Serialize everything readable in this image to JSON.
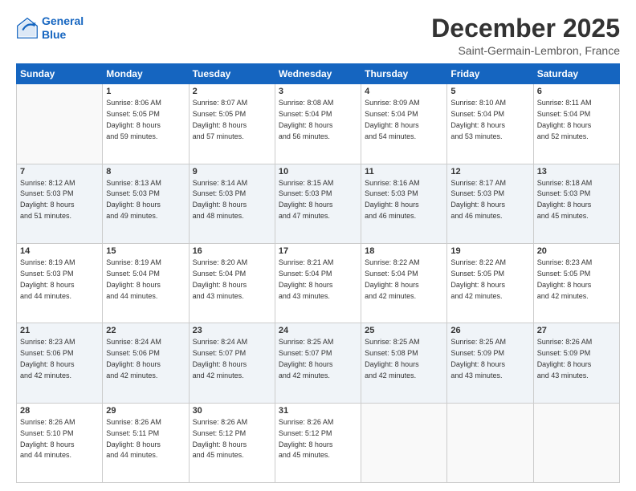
{
  "header": {
    "logo_line1": "General",
    "logo_line2": "Blue",
    "month_title": "December 2025",
    "location": "Saint-Germain-Lembron, France"
  },
  "weekdays": [
    "Sunday",
    "Monday",
    "Tuesday",
    "Wednesday",
    "Thursday",
    "Friday",
    "Saturday"
  ],
  "weeks": [
    [
      {
        "day": "",
        "info": ""
      },
      {
        "day": "1",
        "info": "Sunrise: 8:06 AM\nSunset: 5:05 PM\nDaylight: 8 hours\nand 59 minutes."
      },
      {
        "day": "2",
        "info": "Sunrise: 8:07 AM\nSunset: 5:05 PM\nDaylight: 8 hours\nand 57 minutes."
      },
      {
        "day": "3",
        "info": "Sunrise: 8:08 AM\nSunset: 5:04 PM\nDaylight: 8 hours\nand 56 minutes."
      },
      {
        "day": "4",
        "info": "Sunrise: 8:09 AM\nSunset: 5:04 PM\nDaylight: 8 hours\nand 54 minutes."
      },
      {
        "day": "5",
        "info": "Sunrise: 8:10 AM\nSunset: 5:04 PM\nDaylight: 8 hours\nand 53 minutes."
      },
      {
        "day": "6",
        "info": "Sunrise: 8:11 AM\nSunset: 5:04 PM\nDaylight: 8 hours\nand 52 minutes."
      }
    ],
    [
      {
        "day": "7",
        "info": "Sunrise: 8:12 AM\nSunset: 5:03 PM\nDaylight: 8 hours\nand 51 minutes."
      },
      {
        "day": "8",
        "info": "Sunrise: 8:13 AM\nSunset: 5:03 PM\nDaylight: 8 hours\nand 49 minutes."
      },
      {
        "day": "9",
        "info": "Sunrise: 8:14 AM\nSunset: 5:03 PM\nDaylight: 8 hours\nand 48 minutes."
      },
      {
        "day": "10",
        "info": "Sunrise: 8:15 AM\nSunset: 5:03 PM\nDaylight: 8 hours\nand 47 minutes."
      },
      {
        "day": "11",
        "info": "Sunrise: 8:16 AM\nSunset: 5:03 PM\nDaylight: 8 hours\nand 46 minutes."
      },
      {
        "day": "12",
        "info": "Sunrise: 8:17 AM\nSunset: 5:03 PM\nDaylight: 8 hours\nand 46 minutes."
      },
      {
        "day": "13",
        "info": "Sunrise: 8:18 AM\nSunset: 5:03 PM\nDaylight: 8 hours\nand 45 minutes."
      }
    ],
    [
      {
        "day": "14",
        "info": "Sunrise: 8:19 AM\nSunset: 5:03 PM\nDaylight: 8 hours\nand 44 minutes."
      },
      {
        "day": "15",
        "info": "Sunrise: 8:19 AM\nSunset: 5:04 PM\nDaylight: 8 hours\nand 44 minutes."
      },
      {
        "day": "16",
        "info": "Sunrise: 8:20 AM\nSunset: 5:04 PM\nDaylight: 8 hours\nand 43 minutes."
      },
      {
        "day": "17",
        "info": "Sunrise: 8:21 AM\nSunset: 5:04 PM\nDaylight: 8 hours\nand 43 minutes."
      },
      {
        "day": "18",
        "info": "Sunrise: 8:22 AM\nSunset: 5:04 PM\nDaylight: 8 hours\nand 42 minutes."
      },
      {
        "day": "19",
        "info": "Sunrise: 8:22 AM\nSunset: 5:05 PM\nDaylight: 8 hours\nand 42 minutes."
      },
      {
        "day": "20",
        "info": "Sunrise: 8:23 AM\nSunset: 5:05 PM\nDaylight: 8 hours\nand 42 minutes."
      }
    ],
    [
      {
        "day": "21",
        "info": "Sunrise: 8:23 AM\nSunset: 5:06 PM\nDaylight: 8 hours\nand 42 minutes."
      },
      {
        "day": "22",
        "info": "Sunrise: 8:24 AM\nSunset: 5:06 PM\nDaylight: 8 hours\nand 42 minutes."
      },
      {
        "day": "23",
        "info": "Sunrise: 8:24 AM\nSunset: 5:07 PM\nDaylight: 8 hours\nand 42 minutes."
      },
      {
        "day": "24",
        "info": "Sunrise: 8:25 AM\nSunset: 5:07 PM\nDaylight: 8 hours\nand 42 minutes."
      },
      {
        "day": "25",
        "info": "Sunrise: 8:25 AM\nSunset: 5:08 PM\nDaylight: 8 hours\nand 42 minutes."
      },
      {
        "day": "26",
        "info": "Sunrise: 8:25 AM\nSunset: 5:09 PM\nDaylight: 8 hours\nand 43 minutes."
      },
      {
        "day": "27",
        "info": "Sunrise: 8:26 AM\nSunset: 5:09 PM\nDaylight: 8 hours\nand 43 minutes."
      }
    ],
    [
      {
        "day": "28",
        "info": "Sunrise: 8:26 AM\nSunset: 5:10 PM\nDaylight: 8 hours\nand 44 minutes."
      },
      {
        "day": "29",
        "info": "Sunrise: 8:26 AM\nSunset: 5:11 PM\nDaylight: 8 hours\nand 44 minutes."
      },
      {
        "day": "30",
        "info": "Sunrise: 8:26 AM\nSunset: 5:12 PM\nDaylight: 8 hours\nand 45 minutes."
      },
      {
        "day": "31",
        "info": "Sunrise: 8:26 AM\nSunset: 5:12 PM\nDaylight: 8 hours\nand 45 minutes."
      },
      {
        "day": "",
        "info": ""
      },
      {
        "day": "",
        "info": ""
      },
      {
        "day": "",
        "info": ""
      }
    ]
  ]
}
